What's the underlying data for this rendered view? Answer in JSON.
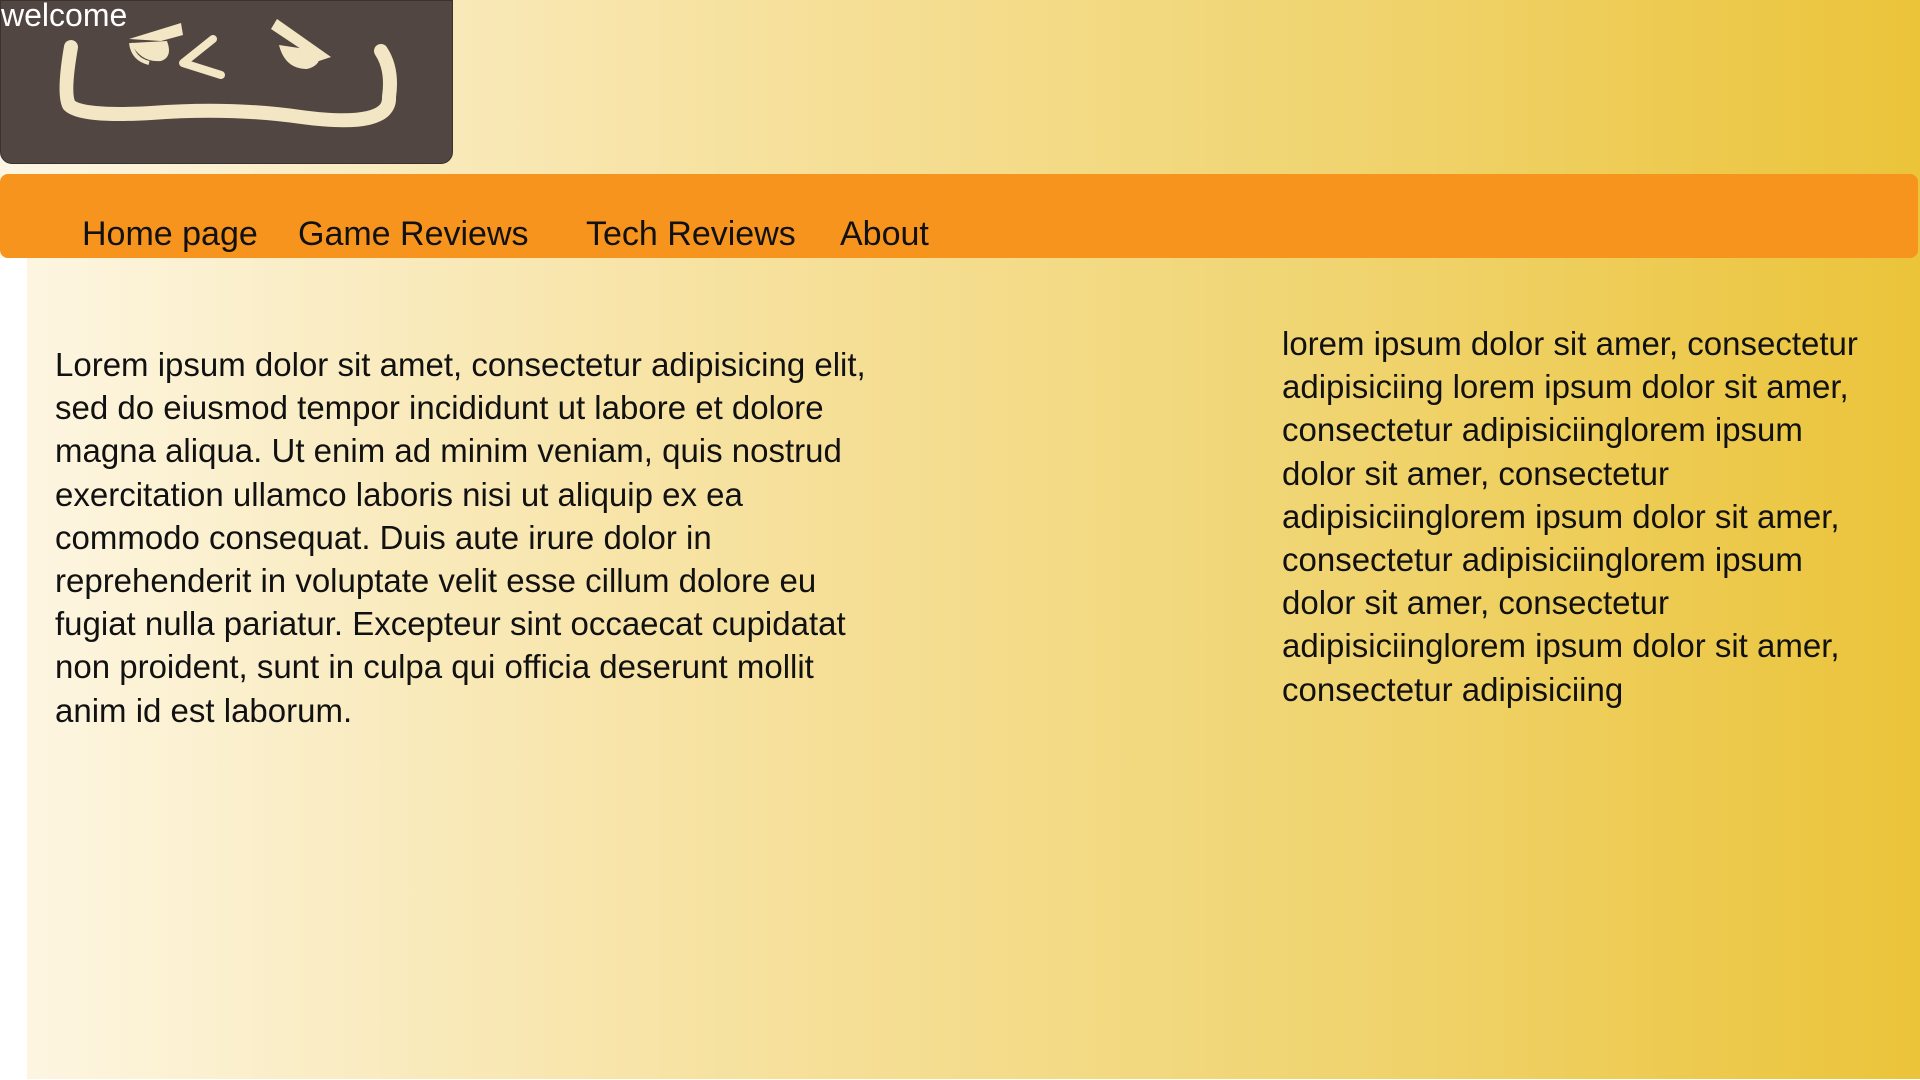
{
  "header": {
    "welcome_text": "welcome",
    "logo_icon": "smirking-face-logo"
  },
  "nav": {
    "items": [
      {
        "label": "Home page"
      },
      {
        "label": "Game Reviews"
      },
      {
        "label": "Tech Reviews"
      },
      {
        "label": "About"
      }
    ]
  },
  "main": {
    "left_text": "Lorem ipsum dolor sit amet, consectetur adipisicing elit, sed do eiusmod tempor incididunt ut labore et dolore magna aliqua. Ut enim ad minim veniam, quis nostrud exercitation ullamco laboris nisi ut aliquip ex ea commodo consequat. Duis aute irure dolor in reprehenderit in voluptate velit esse cillum dolore eu fugiat nulla pariatur. Excepteur sint occaecat cupidatat non proident, sunt in culpa qui officia deserunt mollit anim id est laborum.",
    "right_text": "lorem ipsum dolor sit amer, consectetur adipisiciing lorem ipsum dolor sit amer, consectetur adipisiciinglorem ipsum dolor sit amer, consectetur adipisiciinglorem ipsum dolor sit amer, consectetur adipisiciinglorem ipsum dolor sit amer, consectetur adipisiciinglorem ipsum dolor sit amer, consectetur adipisiciing"
  },
  "colors": {
    "logo_bg": "#514642",
    "logo_stroke": "#f3e6c4",
    "nav_bg": "#f7941e",
    "gradient_start": "#fdf6e3",
    "gradient_end": "#ebc43a"
  }
}
